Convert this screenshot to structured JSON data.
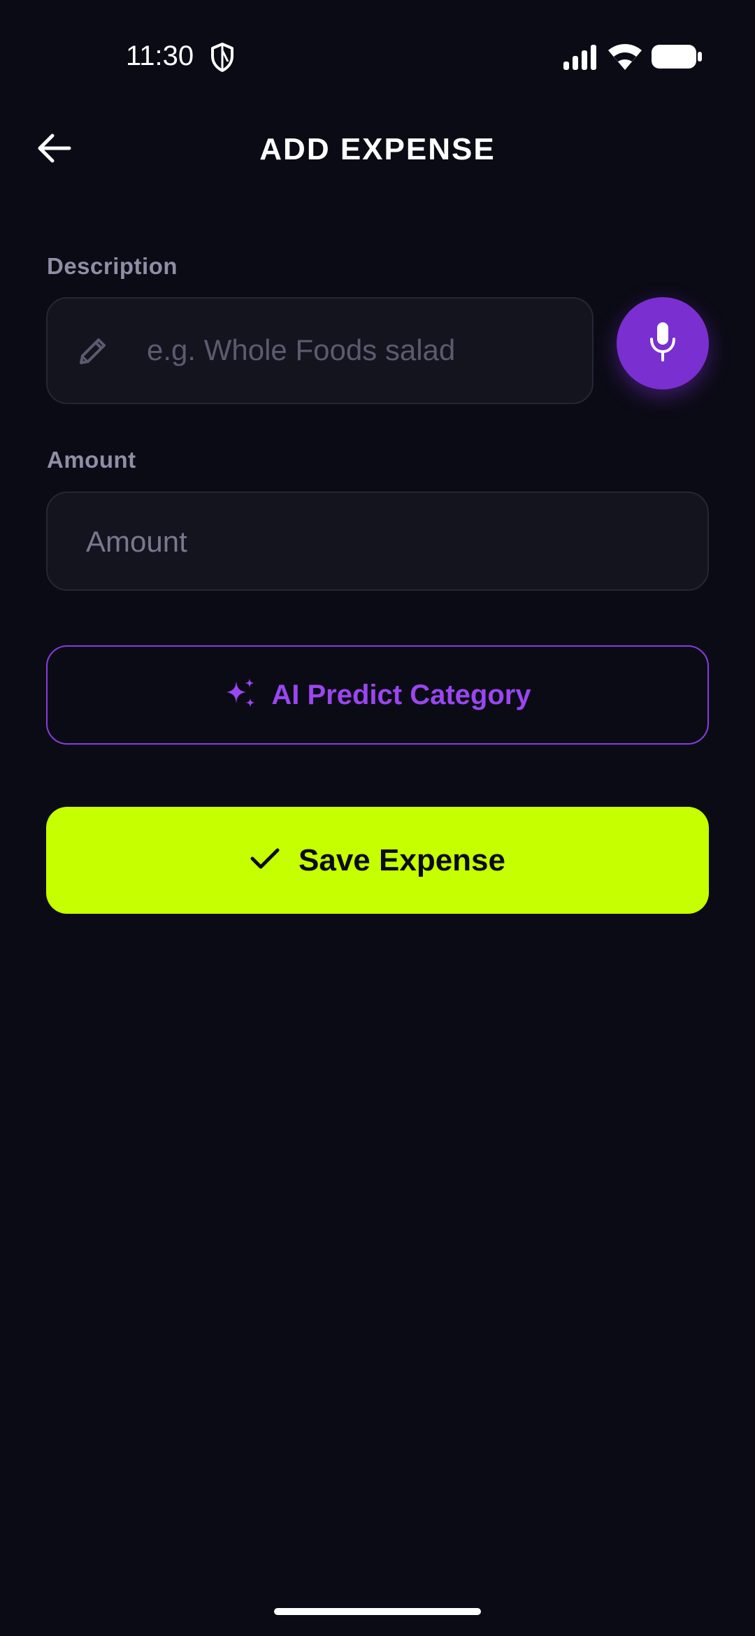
{
  "status_bar": {
    "time": "11:30",
    "icons": [
      "shield-icon",
      "signal-icon",
      "wifi-icon",
      "battery-icon"
    ]
  },
  "header": {
    "back_icon": "arrow-left-icon",
    "title": "ADD EXPENSE"
  },
  "form": {
    "description": {
      "label": "Description",
      "placeholder": "e.g. Whole Foods salad",
      "value": "",
      "icon": "pencil-icon"
    },
    "voice_button_icon": "microphone-icon",
    "amount": {
      "label": "Amount",
      "placeholder": "Amount",
      "value": ""
    }
  },
  "ai_button": {
    "label": "AI Predict Category",
    "icon": "sparkles-icon"
  },
  "save_button": {
    "label": "Save Expense",
    "icon": "check-icon"
  },
  "colors": {
    "background": "#0b0b15",
    "input_bg": "#14141f",
    "accent_purple": "#7a2fd0",
    "ai_purple": "#9a46f0",
    "save_green": "#c6ff00"
  }
}
